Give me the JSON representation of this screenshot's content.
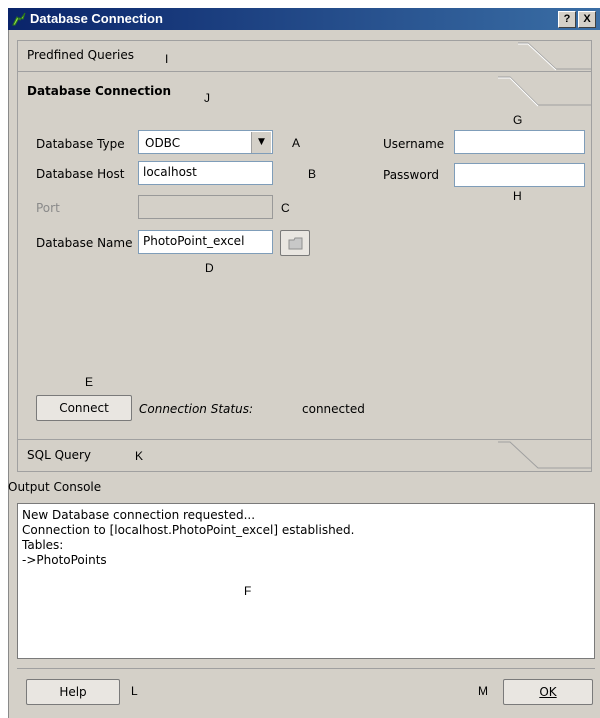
{
  "window": {
    "title": "Database Connection",
    "help_button": "?",
    "close_button": "X",
    "icon": "app-icon"
  },
  "tabs": {
    "predefined_queries": "Predfined Queries",
    "database_connection": "Database Connection",
    "sql_query": "SQL Query"
  },
  "form": {
    "database_type_label": "Database Type",
    "database_type_value": "ODBC",
    "database_host_label": "Database Host",
    "database_host_value": "localhost",
    "port_label": "Port",
    "port_value": "",
    "database_name_label": "Database Name",
    "database_name_value": "PhotoPoint_excel",
    "username_label": "Username",
    "username_value": "",
    "password_label": "Password",
    "password_value": ""
  },
  "connect": {
    "button_label": "Connect",
    "status_label": "Connection Status:",
    "status_value": "connected"
  },
  "console": {
    "label": "Output Console",
    "text": "New Database connection requested...\nConnection to [localhost.PhotoPoint_excel] established.\nTables:\n->PhotoPoints"
  },
  "footer": {
    "help_button": "Help",
    "ok_button": "OK"
  },
  "annotations": {
    "A": "A",
    "B": "B",
    "C": "C",
    "D": "D",
    "E": "E",
    "F": "F",
    "G": "G",
    "H": "H",
    "I": "I",
    "J": "J",
    "K": "K",
    "L": "L",
    "M": "M"
  },
  "colors": {
    "title_start": "#0a246a",
    "title_end": "#3a6ea5",
    "dialog_bg": "#d4d0c8"
  }
}
